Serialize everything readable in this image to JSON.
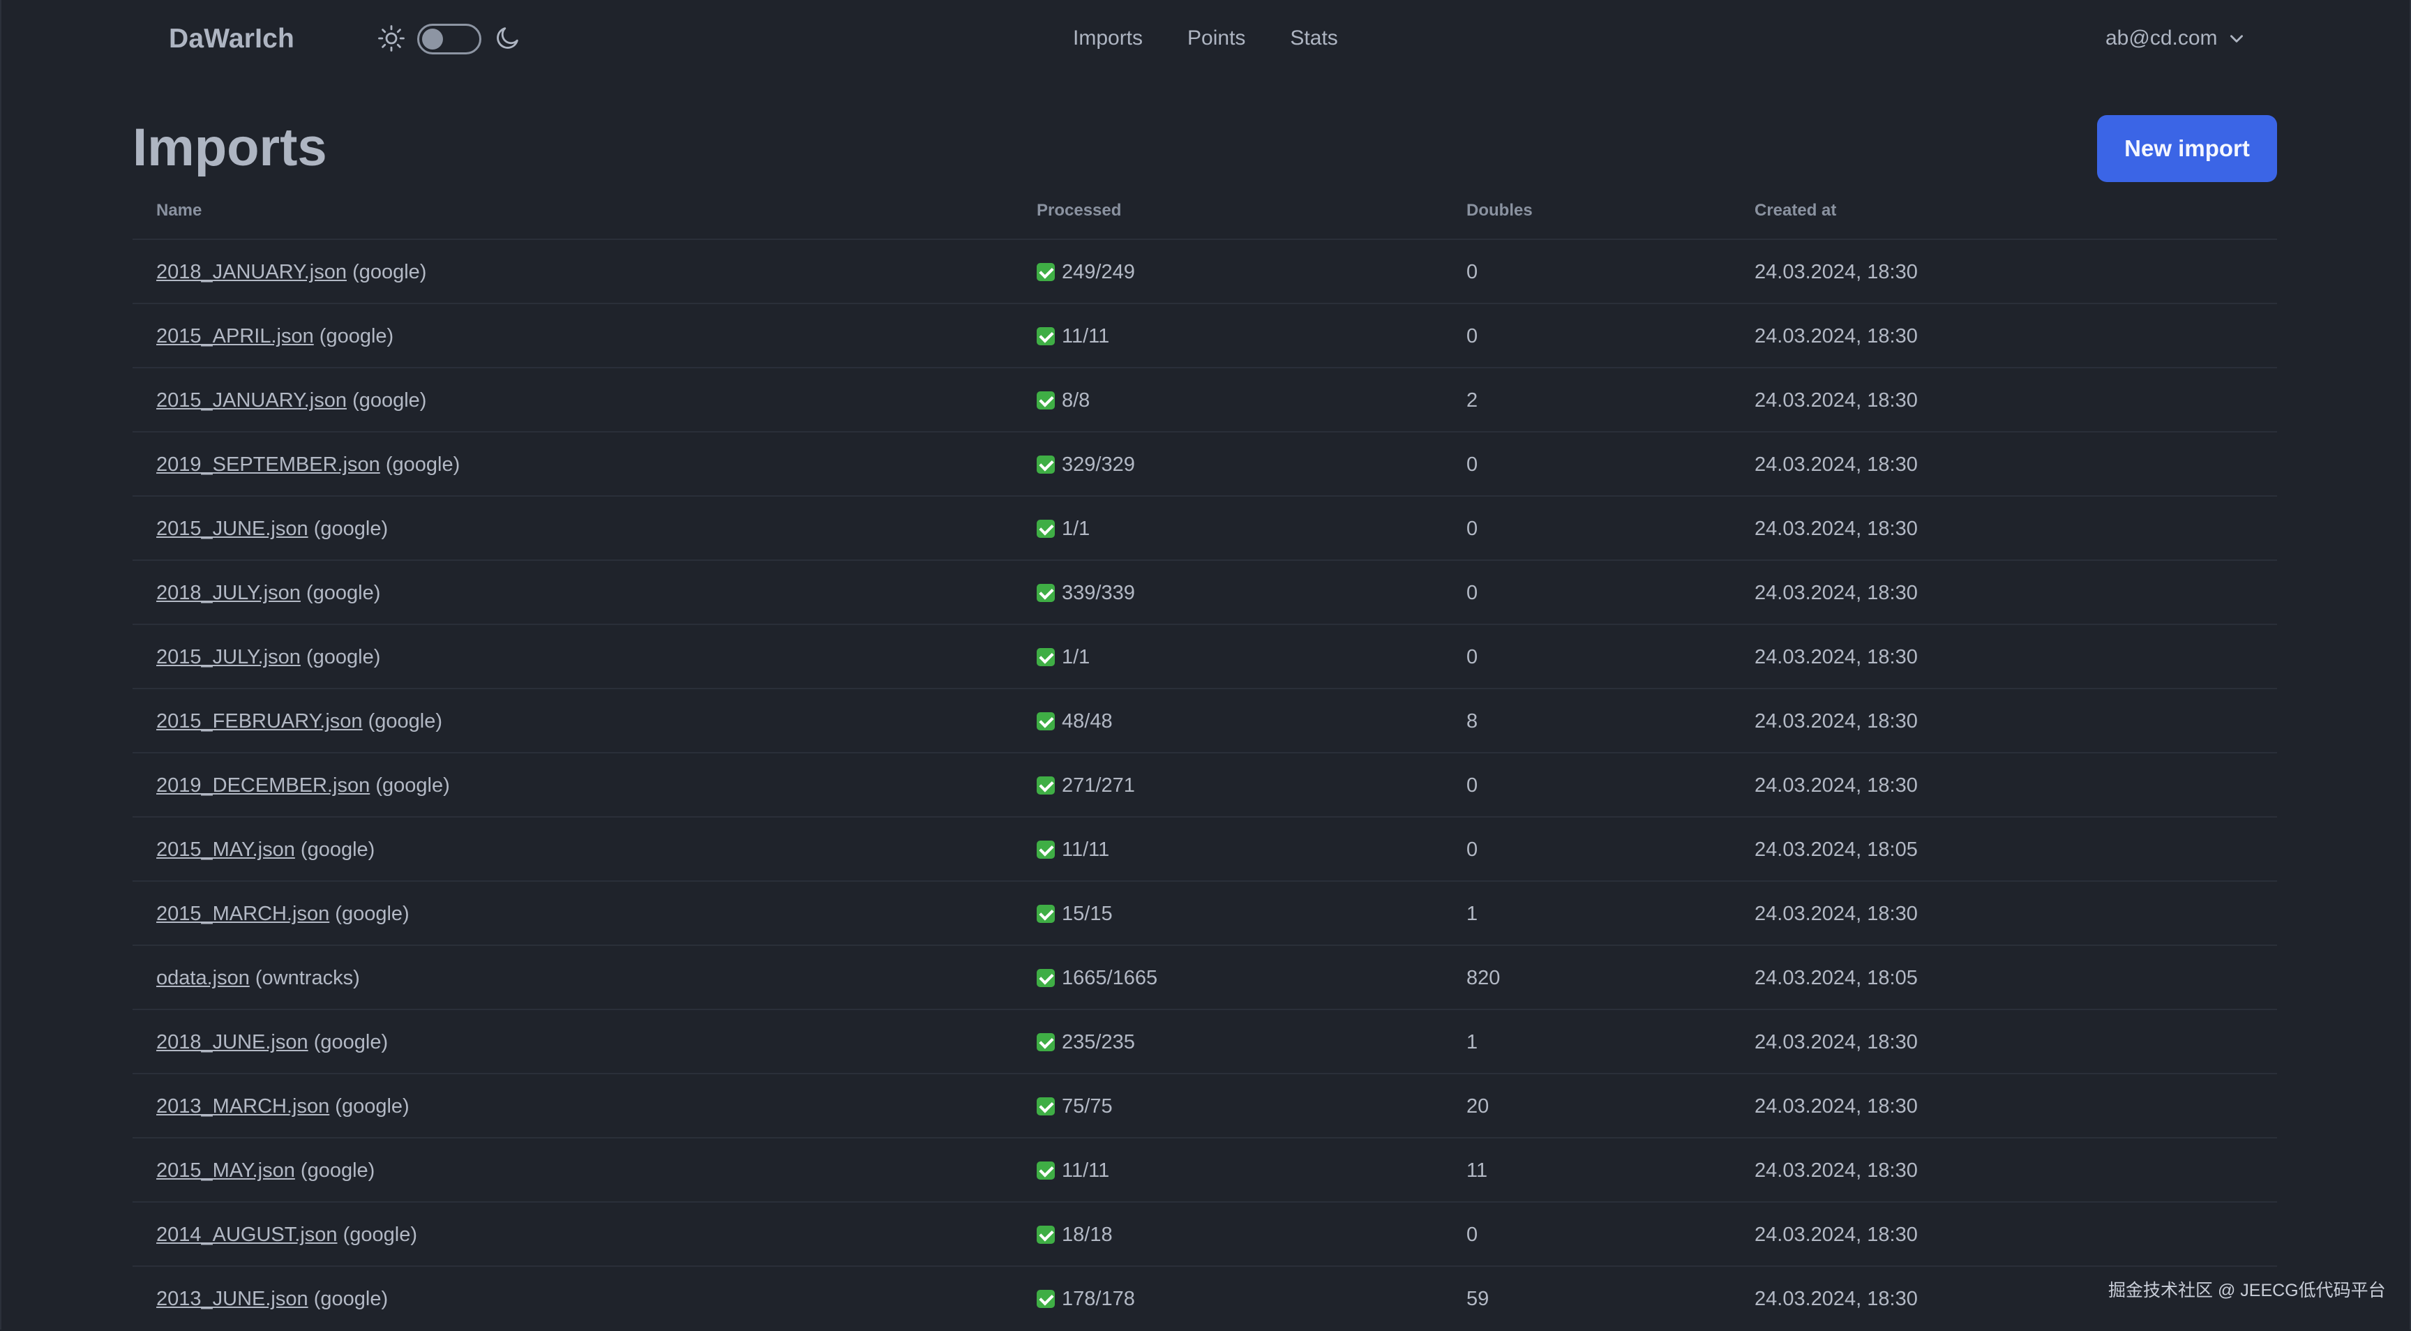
{
  "nav": {
    "brand": "DaWarIch",
    "links": [
      "Imports",
      "Points",
      "Stats"
    ],
    "user_email": "ab@cd.com"
  },
  "page": {
    "title": "Imports",
    "new_button": "New import"
  },
  "table": {
    "columns": [
      "Name",
      "Processed",
      "Doubles",
      "Created at"
    ],
    "rows": [
      {
        "file": "2018_JANUARY.json",
        "source": "(google)",
        "processed": "249/249",
        "doubles": "0",
        "created": "24.03.2024, 18:30"
      },
      {
        "file": "2015_APRIL.json",
        "source": "(google)",
        "processed": "11/11",
        "doubles": "0",
        "created": "24.03.2024, 18:30"
      },
      {
        "file": "2015_JANUARY.json",
        "source": "(google)",
        "processed": "8/8",
        "doubles": "2",
        "created": "24.03.2024, 18:30"
      },
      {
        "file": "2019_SEPTEMBER.json",
        "source": "(google)",
        "processed": "329/329",
        "doubles": "0",
        "created": "24.03.2024, 18:30"
      },
      {
        "file": "2015_JUNE.json",
        "source": "(google)",
        "processed": "1/1",
        "doubles": "0",
        "created": "24.03.2024, 18:30"
      },
      {
        "file": "2018_JULY.json",
        "source": "(google)",
        "processed": "339/339",
        "doubles": "0",
        "created": "24.03.2024, 18:30"
      },
      {
        "file": "2015_JULY.json",
        "source": "(google)",
        "processed": "1/1",
        "doubles": "0",
        "created": "24.03.2024, 18:30"
      },
      {
        "file": "2015_FEBRUARY.json",
        "source": "(google)",
        "processed": "48/48",
        "doubles": "8",
        "created": "24.03.2024, 18:30"
      },
      {
        "file": "2019_DECEMBER.json",
        "source": "(google)",
        "processed": "271/271",
        "doubles": "0",
        "created": "24.03.2024, 18:30"
      },
      {
        "file": "2015_MAY.json",
        "source": "(google)",
        "processed": "11/11",
        "doubles": "0",
        "created": "24.03.2024, 18:05"
      },
      {
        "file": "2015_MARCH.json",
        "source": "(google)",
        "processed": "15/15",
        "doubles": "1",
        "created": "24.03.2024, 18:30"
      },
      {
        "file": "odata.json",
        "source": "(owntracks)",
        "processed": "1665/1665",
        "doubles": "820",
        "created": "24.03.2024, 18:05"
      },
      {
        "file": "2018_JUNE.json",
        "source": "(google)",
        "processed": "235/235",
        "doubles": "1",
        "created": "24.03.2024, 18:30"
      },
      {
        "file": "2013_MARCH.json",
        "source": "(google)",
        "processed": "75/75",
        "doubles": "20",
        "created": "24.03.2024, 18:30"
      },
      {
        "file": "2015_MAY.json",
        "source": "(google)",
        "processed": "11/11",
        "doubles": "11",
        "created": "24.03.2024, 18:30"
      },
      {
        "file": "2014_AUGUST.json",
        "source": "(google)",
        "processed": "18/18",
        "doubles": "0",
        "created": "24.03.2024, 18:30"
      },
      {
        "file": "2013_JUNE.json",
        "source": "(google)",
        "processed": "178/178",
        "doubles": "59",
        "created": "24.03.2024, 18:30"
      }
    ]
  },
  "watermark": "掘金技术社区 @ JEECG低代码平台",
  "colors": {
    "background": "#1f232b",
    "primary_button": "#3b65e6",
    "check": "#3fae45"
  }
}
